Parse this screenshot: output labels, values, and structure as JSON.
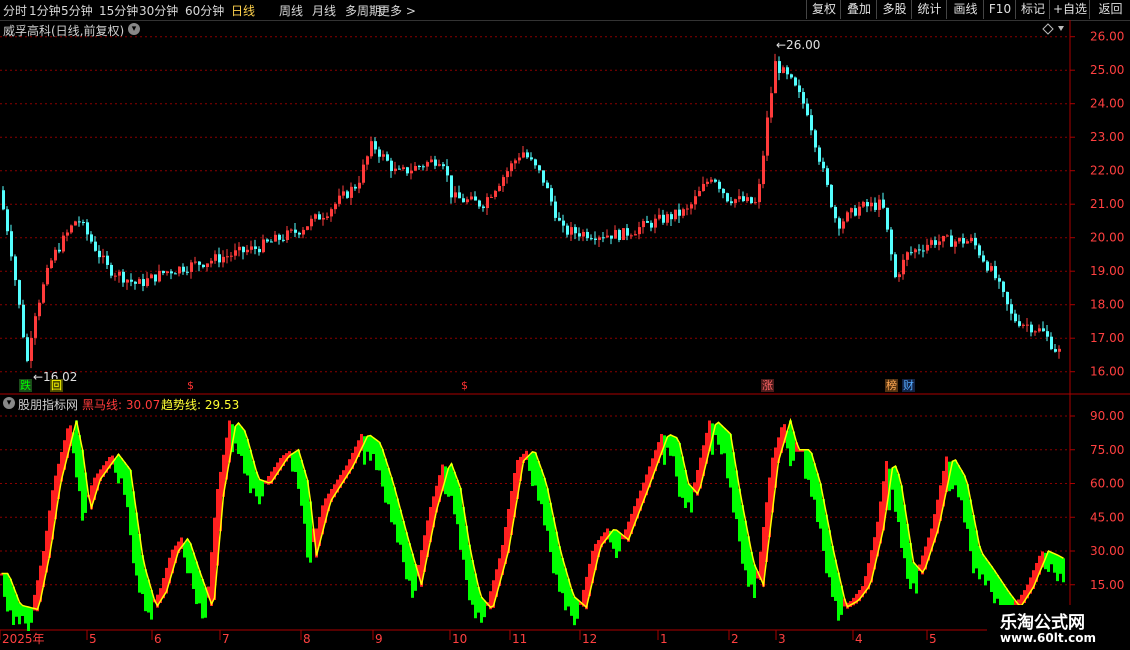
{
  "toolbar": {
    "periods": [
      "分时",
      "1分钟",
      "5分钟",
      "15分钟",
      "30分钟",
      "60分钟",
      "日线",
      "周线",
      "月线",
      "多周期",
      "更多 >"
    ],
    "active_period": "日线",
    "right_buttons": [
      "复权",
      "叠加",
      "多股",
      "统计",
      "画线",
      "F10",
      "标记",
      "+自选",
      "返回"
    ]
  },
  "stock_title": "威孚高科(日线,前复权)",
  "main_chart": {
    "price_axis": [
      "26.00",
      "25.00",
      "24.00",
      "23.00",
      "22.00",
      "21.00",
      "20.00",
      "19.00",
      "18.00",
      "17.00",
      "16.00"
    ],
    "price_range": [
      15.6,
      26.5
    ],
    "high_label": "26.00",
    "low_label": "16.02",
    "colors": {
      "up": "#ff3b3b",
      "down": "#54ffff",
      "grid": "#8b0000"
    }
  },
  "signals": [
    {
      "text": "跌",
      "color": "#00ff00",
      "bg": "#1a4d1a"
    },
    {
      "text": "回",
      "color": "#ffff00",
      "bg": "#4d4d00"
    },
    {
      "text": "$",
      "color": "#ff3333",
      "bg": "transparent"
    },
    {
      "text": "$",
      "color": "#ff3333",
      "bg": "transparent"
    },
    {
      "text": "涨",
      "color": "#ff6666",
      "bg": "#4d1a1a"
    },
    {
      "text": "榜",
      "color": "#ffaa55",
      "bg": "#553311"
    },
    {
      "text": "财",
      "color": "#55aaff",
      "bg": "#112244"
    }
  ],
  "indicator": {
    "name": "股朋指标网",
    "heima_label": "黑马线: 30.07",
    "trend_label": "趋势线: 29.53",
    "axis": [
      "90.00",
      "75.00",
      "60.00",
      "45.00",
      "30.00",
      "15.00"
    ],
    "range": [
      -2,
      97
    ],
    "colors": {
      "heima": "#ff2020",
      "trend": "#ffff00",
      "fall": "#00ff00"
    }
  },
  "time_axis": [
    "2025年",
    "5",
    "6",
    "7",
    "8",
    "9",
    "10",
    "11",
    "12",
    "1",
    "2",
    "3",
    "4",
    "5"
  ],
  "logo": {
    "line1": "乐淘公式网",
    "line2": "www.60lt.com"
  }
}
